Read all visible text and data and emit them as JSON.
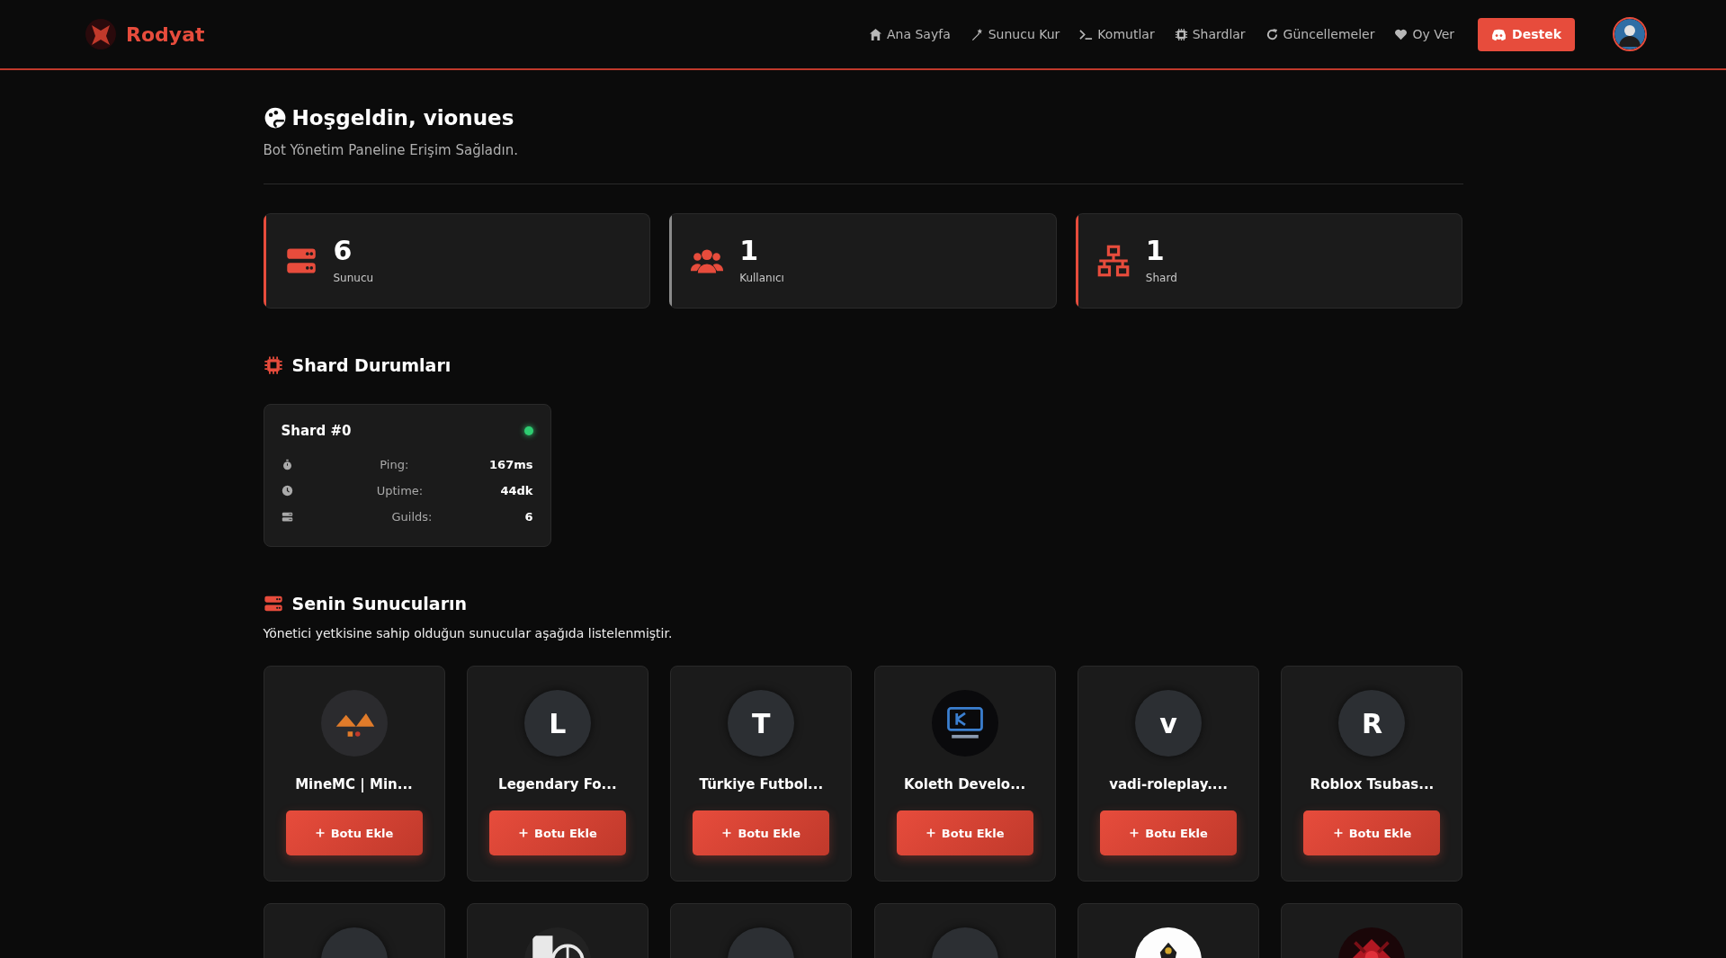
{
  "brand": {
    "name": "Rodyat"
  },
  "nav": [
    {
      "label": "Ana Sayfa"
    },
    {
      "label": "Sunucu Kur"
    },
    {
      "label": "Komutlar"
    },
    {
      "label": "Shardlar"
    },
    {
      "label": "Güncellemeler"
    },
    {
      "label": "Oy Ver"
    }
  ],
  "support_button": {
    "label": "Destek"
  },
  "welcome": {
    "title": "Hoşgeldin, vionues",
    "subtitle": "Bot Yönetim Paneline Erişim Sağladın."
  },
  "stats": [
    {
      "value": "6",
      "label": "Sunucu",
      "color": "#e74c3c"
    },
    {
      "value": "1",
      "label": "Kullanıcı",
      "color": "#8a8a8a"
    },
    {
      "value": "1",
      "label": "Shard",
      "color": "#e74c3c"
    }
  ],
  "shards_section": {
    "title": "Shard Durumları"
  },
  "shards": [
    {
      "name": "Shard #0",
      "color": "#2ecc71",
      "rows": [
        {
          "label": "Ping:",
          "value": "167ms"
        },
        {
          "label": "Uptime:",
          "value": "44dk"
        },
        {
          "label": "Guilds:",
          "value": "6"
        }
      ]
    }
  ],
  "servers_section": {
    "title": "Senin Sunucuların",
    "description": "Yönetici yetkisine sahip olduğun sunucular aşağıda listelenmiştir."
  },
  "servers": [
    {
      "name": "MineMC | Min...",
      "avatar": {
        "kind": "picture"
      },
      "button": "Botu Ekle"
    },
    {
      "name": "Legendary Fo...",
      "avatar": {
        "kind": "letter",
        "letter": "L"
      },
      "button": "Botu Ekle"
    },
    {
      "name": "Türkiye Futbol...",
      "avatar": {
        "kind": "letter",
        "letter": "T"
      },
      "button": "Botu Ekle"
    },
    {
      "name": "Koleth Develo...",
      "avatar": {
        "kind": "picture"
      },
      "button": "Botu Ekle"
    },
    {
      "name": "vadi-roleplay....",
      "avatar": {
        "kind": "letter",
        "letter": "v"
      },
      "button": "Botu Ekle"
    },
    {
      "name": "Roblox Tsubas...",
      "avatar": {
        "kind": "letter",
        "letter": "R"
      },
      "button": "Botu Ekle"
    },
    {
      "avatar": {
        "kind": "blank"
      }
    },
    {
      "avatar": {
        "kind": "picture"
      }
    },
    {
      "avatar": {
        "kind": "blank"
      }
    },
    {
      "avatar": {
        "kind": "blank"
      }
    },
    {
      "avatar": {
        "kind": "picture"
      }
    },
    {
      "avatar": {
        "kind": "picture"
      }
    }
  ]
}
